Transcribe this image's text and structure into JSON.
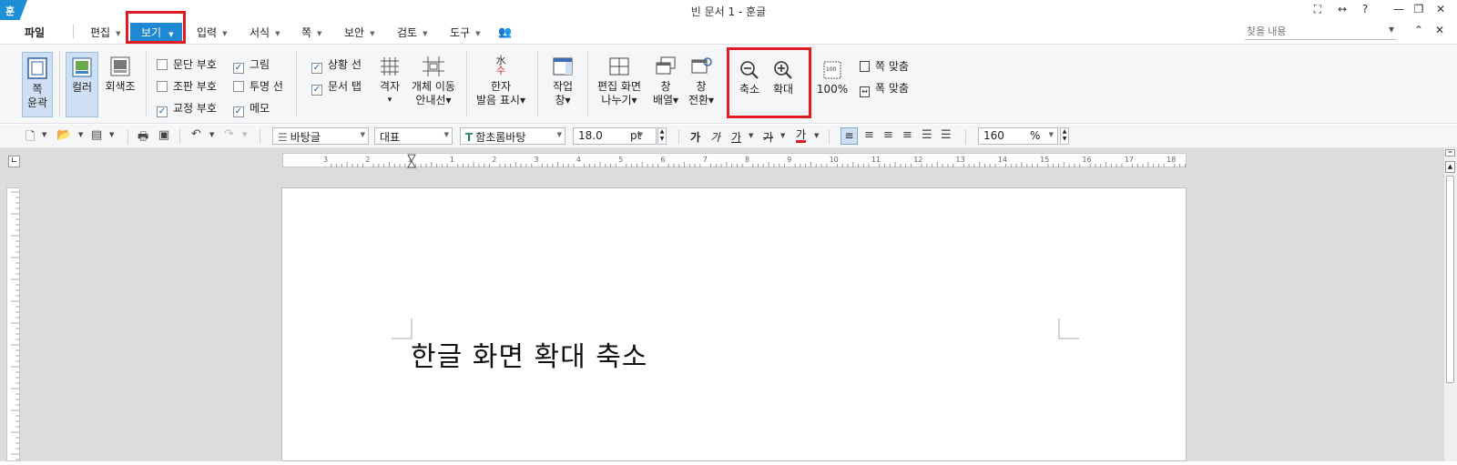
{
  "titlebar": {
    "logo": "훈",
    "title": "빈 문서 1 - 훈글",
    "controls": {
      "fullscreen": "⛶",
      "resize": "↔",
      "help": "?",
      "minimize": "—",
      "restore": "❐",
      "close": "✕"
    }
  },
  "menu": {
    "file": "파일",
    "edit": "편집",
    "view": "보기",
    "input": "입력",
    "format": "서식",
    "page": "쪽",
    "security": "보안",
    "review": "검토",
    "tools": "도구",
    "search_placeholder": "찾을 내용",
    "collapse": "⌃",
    "close": "✕"
  },
  "ribbon": {
    "page_outline": [
      "쪽",
      "윤곽"
    ],
    "color": "컬러",
    "grayscale": "회색조",
    "checkboxes": {
      "paragraph_mark": {
        "label": "문단 부호",
        "checked": false
      },
      "layout_mark": {
        "label": "조판 부호",
        "checked": false
      },
      "proof_mark": {
        "label": "교정 부호",
        "checked": true
      },
      "picture": {
        "label": "그림",
        "checked": true
      },
      "transparent_line": {
        "label": "투명 선",
        "checked": false
      },
      "memo": {
        "label": "메모",
        "checked": true
      },
      "status_line": {
        "label": "상황 선",
        "checked": true
      },
      "doc_tab": {
        "label": "문서 탭",
        "checked": true
      }
    },
    "grid": [
      "격자",
      "▾"
    ],
    "object_move_guide": [
      "개체 이동",
      "안내선▾"
    ],
    "hanja": [
      "한자",
      "발음 표시▾"
    ],
    "work_window": [
      "작업",
      "창▾"
    ],
    "split_view": [
      "편집 화면",
      "나누기▾"
    ],
    "window_arrange": [
      "창",
      "배열▾"
    ],
    "window_switch": [
      "창",
      "전환▾"
    ],
    "zoom_out": "축소",
    "zoom_in": "확대",
    "zoom_100": "100%",
    "fit_page_1": "쪽 맞춤",
    "fit_page_2": "폭 맞춤"
  },
  "toolbar": {
    "style": "바탕글",
    "representative": "대표",
    "font": "함초롬바탕",
    "size": "18.0",
    "size_unit": "pt",
    "zoom": "160",
    "zoom_unit": "%",
    "bold": "가",
    "italic": "가",
    "underline": "가",
    "strike": "가",
    "color": "가"
  },
  "ruler": {
    "h_ticks": [
      "3",
      "2",
      "1",
      "1",
      "2",
      "3",
      "4",
      "5",
      "6",
      "7",
      "8",
      "9",
      "10",
      "11",
      "12",
      "13",
      "14",
      "15",
      "16",
      "17",
      "18"
    ]
  },
  "document": {
    "text": "한글 화면 확대 축소"
  }
}
